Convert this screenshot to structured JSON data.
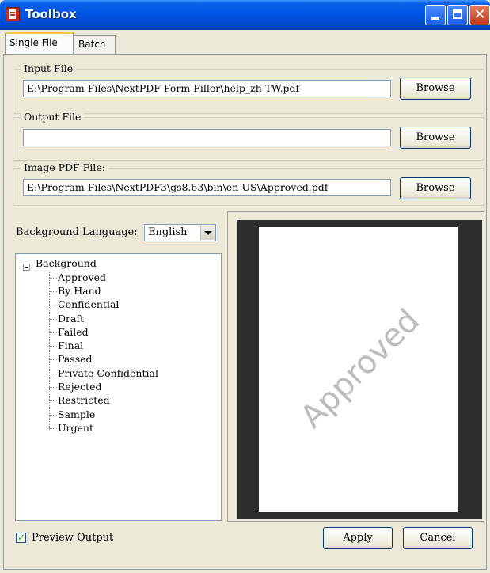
{
  "window": {
    "title": "Toolbox"
  },
  "tabs": [
    {
      "label": "Single File",
      "selected": true
    },
    {
      "label": "Batch",
      "selected": false
    }
  ],
  "input_file": {
    "legend": "Input File",
    "value": "E:\\Program Files\\NextPDF Form Filler\\help_zh-TW.pdf",
    "browse_label": "Browse"
  },
  "output_file": {
    "legend": "Output File",
    "value": "",
    "browse_label": "Browse"
  },
  "image_pdf_file": {
    "legend": "Image PDF File:",
    "value": "E:\\Program Files\\NextPDF3\\gs8.63\\bin\\en-US\\Approved.pdf",
    "browse_label": "Browse"
  },
  "background_language": {
    "label": "Background Language:",
    "selected": "English"
  },
  "tree": {
    "root": "Background",
    "items": [
      "Approved",
      "By Hand",
      "Confidential",
      "Draft",
      "Failed",
      "Final",
      "Passed",
      "Private-Confidential",
      "Rejected",
      "Restricted",
      "Sample",
      "Urgent"
    ]
  },
  "preview": {
    "watermark_text": "Approved"
  },
  "footer": {
    "preview_output_label": "Preview Output",
    "preview_output_checked": true,
    "apply_label": "Apply",
    "cancel_label": "Cancel"
  },
  "icons": {
    "app": "pdf-app-icon",
    "minimize": "minimize-icon",
    "maximize": "maximize-icon",
    "close": "close-icon",
    "dropdown": "chevron-down-icon",
    "tree_toggle": "tree-collapse-icon",
    "check": "checkmark-icon"
  },
  "colors": {
    "titlebar": "#0054e3",
    "close_button": "#c0381a",
    "window_bg": "#ece9d8",
    "preview_bg": "#2d2d2d"
  }
}
